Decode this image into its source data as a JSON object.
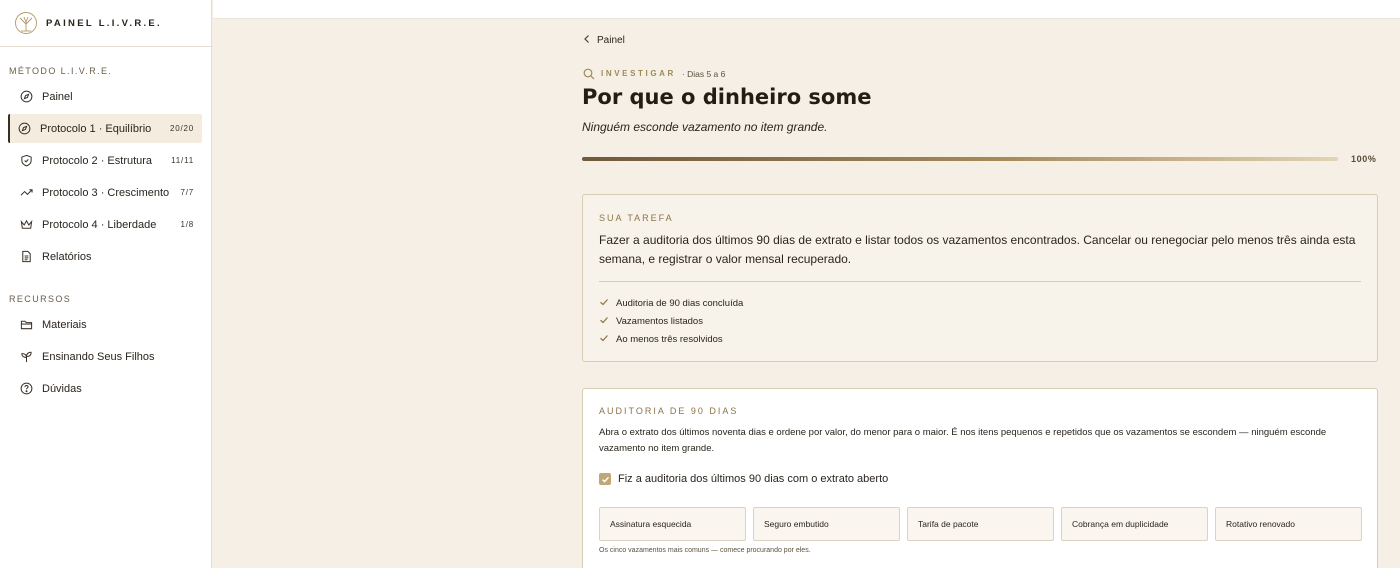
{
  "brand": {
    "name": "PAINEL L.I.V.R.E."
  },
  "sidebar": {
    "section_method": "MÉTODO L.I.V.R.E.",
    "method_items": [
      {
        "label": "Painel",
        "count": "",
        "icon": "compass-icon"
      },
      {
        "label": "Protocolo 1 · Equilíbrio",
        "count": "20/20",
        "icon": "compass-icon",
        "active": true
      },
      {
        "label": "Protocolo 2 · Estrutura",
        "count": "11/11",
        "icon": "shield-icon"
      },
      {
        "label": "Protocolo 3 · Crescimento",
        "count": "7/7",
        "icon": "trending-up-icon"
      },
      {
        "label": "Protocolo 4 · Liberdade",
        "count": "1/8",
        "icon": "crown-icon"
      },
      {
        "label": "Relatórios",
        "count": "",
        "icon": "document-icon"
      }
    ],
    "section_resources": "RECURSOS",
    "resource_items": [
      {
        "label": "Materiais",
        "icon": "folder-icon"
      },
      {
        "label": "Ensinando Seus Filhos",
        "icon": "sprout-icon"
      },
      {
        "label": "Dúvidas",
        "icon": "help-circle-icon"
      }
    ]
  },
  "breadcrumb": {
    "back_label": "Painel"
  },
  "header": {
    "eyebrow": "INVESTIGAR",
    "eyebrow_detail": "· Dias 5 a 6",
    "title": "Por que o dinheiro some",
    "subtitle": "Ninguém esconde vazamento no item grande.",
    "progress_value": 1.0,
    "progress_label": "100%"
  },
  "task": {
    "label": "SUA TAREFA",
    "text": "Fazer a auditoria dos últimos 90 dias de extrato e listar todos os vazamentos encontrados. Cancelar ou renegociar pelo menos três ainda esta semana, e registrar o valor mensal recuperado.",
    "checklist": [
      "Auditoria de 90 dias concluída",
      "Vazamentos listados",
      "Ao menos três resolvidos"
    ]
  },
  "audit": {
    "label": "AUDITORIA DE 90 DIAS",
    "text": "Abra o extrato dos últimos noventa dias e ordene por valor, do menor para o maior. É nos itens pequenos e repetidos que os vazamentos se escondem — ninguém esconde vazamento no item grande.",
    "checkbox_label": "Fiz a auditoria dos últimos 90 dias com o extrato aberto",
    "checkbox_checked": true,
    "chips": [
      "Assinatura esquecida",
      "Seguro embutido",
      "Tarifa de pacote",
      "Cobrança em duplicidade",
      "Rotativo renovado"
    ],
    "chips_note": "Os cinco vazamentos mais comuns — comece procurando por eles."
  },
  "colors": {
    "accent": "#a08a57",
    "background": "#f5efe5",
    "card_tint": "#f8f3ea",
    "border": "#d8ccb5"
  }
}
